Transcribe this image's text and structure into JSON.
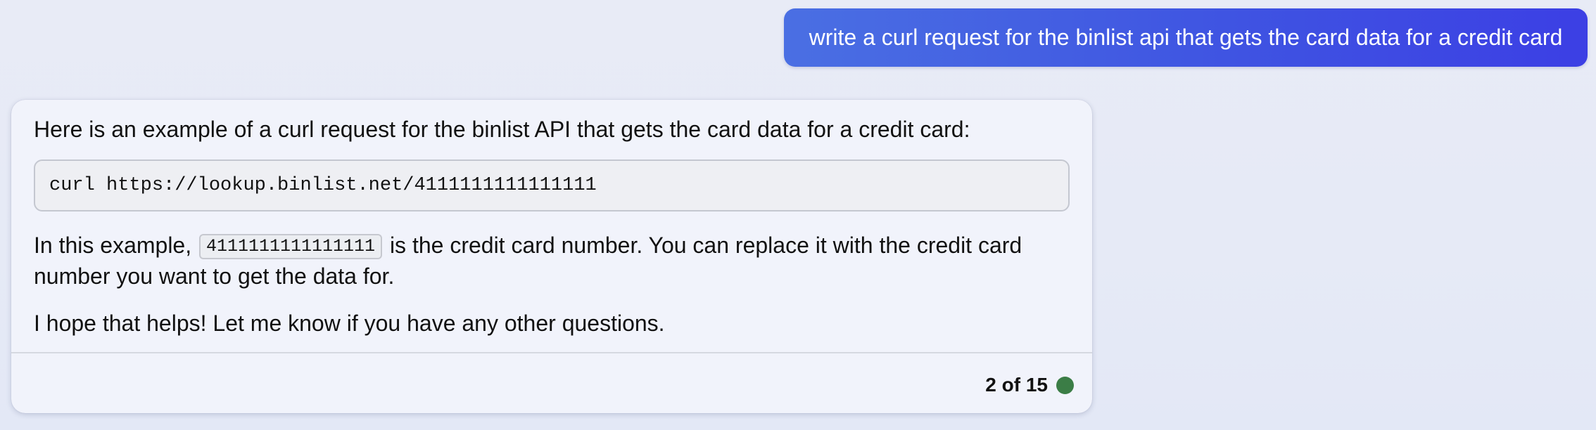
{
  "user_message": {
    "text": "write a curl request for the binlist api that gets the card data for a credit card"
  },
  "response": {
    "intro": "Here is an example of a curl request for the binlist API that gets the card data for a credit card:",
    "code": "curl https://lookup.binlist.net/4111111111111111",
    "para2_before": "In this example, ",
    "inline_code": "4111111111111111",
    "para2_after": " is the credit card number. You can replace it with the credit card number you want to get the data for.",
    "closing": "I hope that helps! Let me know if you have any other questions."
  },
  "footer": {
    "counter": "2 of 15",
    "status_color": "#3b7d46"
  },
  "colors": {
    "user_bubble_accent": "#3f54e2"
  }
}
